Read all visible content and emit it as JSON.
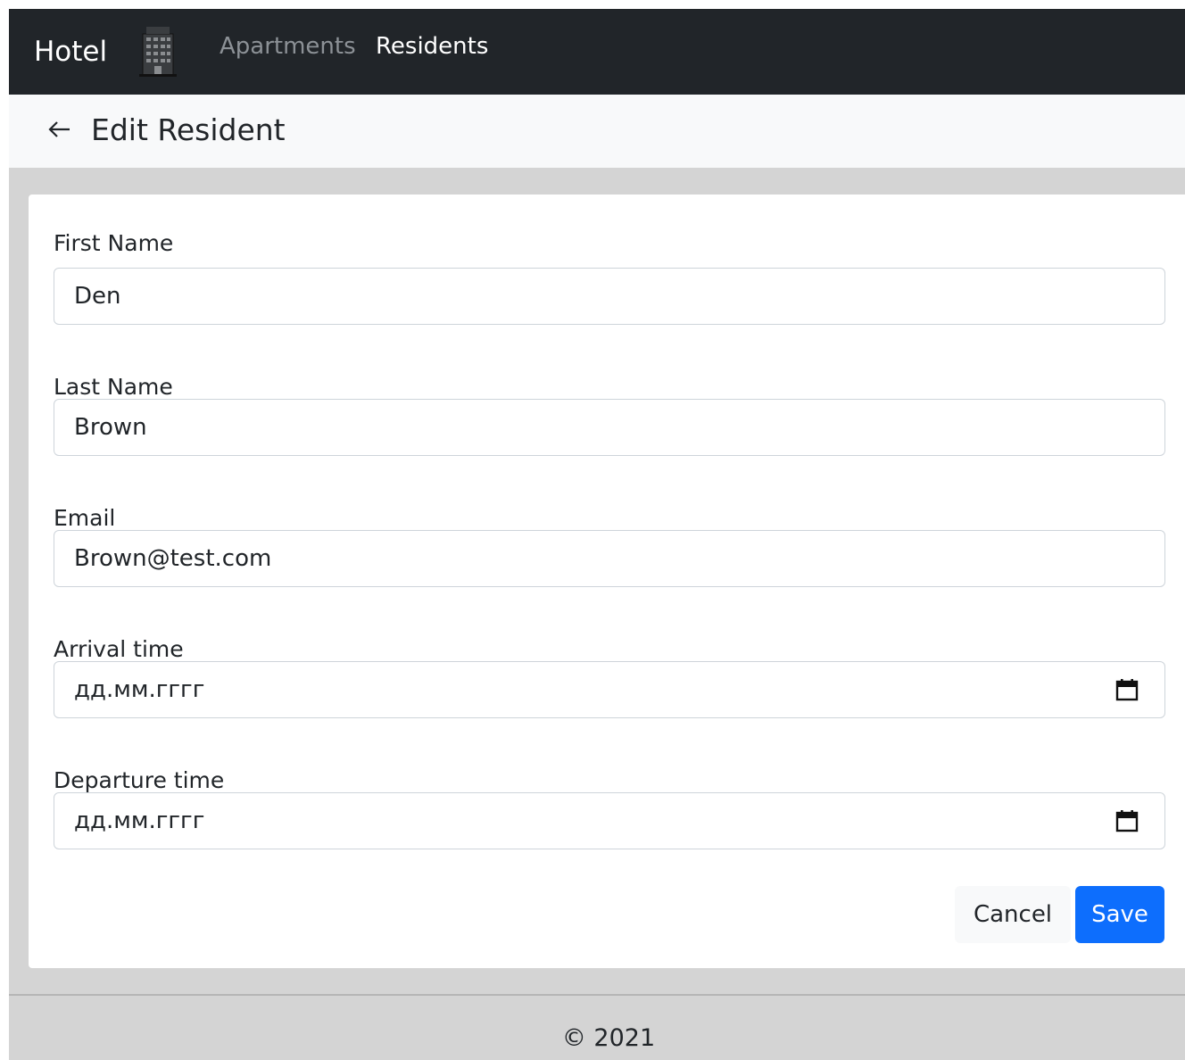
{
  "navbar": {
    "brand": "Hotel",
    "logo_icon": "hotel-building-icon",
    "links": [
      {
        "label": "Apartments",
        "active": false
      },
      {
        "label": "Residents",
        "active": true
      }
    ]
  },
  "header": {
    "back_icon": "arrow-left-icon",
    "title": "Edit Resident"
  },
  "form": {
    "fields": [
      {
        "label": "First Name",
        "value": "Den"
      },
      {
        "label": "Last Name",
        "value": "Brown"
      },
      {
        "label": "Email",
        "value": "Brown@test.com"
      },
      {
        "label": "Arrival time",
        "placeholder": "дд.мм.гггг",
        "icon": "calendar-icon"
      },
      {
        "label": "Departure time",
        "placeholder": "дд.мм.гггг",
        "icon": "calendar-icon"
      }
    ],
    "cancel_label": "Cancel",
    "save_label": "Save"
  },
  "footer": {
    "text": "© 2021"
  },
  "colors": {
    "navbar_bg": "#212529",
    "primary": "#0d6efd",
    "page_bg": "#d4d4d4"
  }
}
